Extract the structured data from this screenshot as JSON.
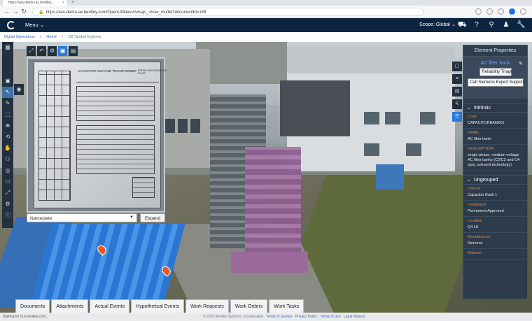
{
  "browser": {
    "tab_title": "https://asv-demo-ax.bentley...",
    "url": "https://asv-demo-ax.bentley.com/OpenUtilities/#/visajs_show_model?documentId=189"
  },
  "header": {
    "menu_label": "Menu",
    "scope_label": "Scope: Global"
  },
  "breadcrumb": {
    "items": [
      "Digital Operations",
      "Home",
      "3D Spatial Explorer"
    ]
  },
  "nameplate": {
    "plate_title": "CAPACITOR VOLTAGE TRANSFORMER",
    "plate_right_title": "RATING AND DIAGRAMS PLATE",
    "select_value": "Nameplate",
    "expand_label": "Expand"
  },
  "bottom_tabs": [
    "Documents",
    "Attachments",
    "Actual Events",
    "Hypothetical Events",
    "Work Requests",
    "Work Orders",
    "Work Tasks"
  ],
  "status": {
    "left": "Waiting for ts.b.bentley.com...",
    "copyright": "© 2019 Bentley Systems, Incorporated",
    "links": [
      "Terms of Service",
      "Privacy Policy",
      "Terms of Use",
      "Legal Notices"
    ]
  },
  "properties": {
    "panel_title": "Element Properties",
    "element_name": "AC filter bank",
    "reliability_button": "Reliability Triage",
    "siemens_button": "Call Siemens Expert Support",
    "intrinsic_label": "Intrinsic",
    "ungrouped_label": "Ungrouped",
    "intrinsic_fields": [
      {
        "label": "Code",
        "value": "CAPACITORBANK01"
      },
      {
        "label": "NAME",
        "value": "AC filter bank"
      },
      {
        "label": "DESCRIPTION",
        "value": "single-phase, medium-voltage AC filter banks (C2/C3 and C4-type, unfused technology)"
      }
    ],
    "ungrouped_fields": [
      {
        "label": "IdShort",
        "value": "Capacitor Bank 1"
      },
      {
        "label": "Installation",
        "value": "Permanent Approved"
      },
      {
        "label": "Location",
        "value": "Q4 L8"
      },
      {
        "label": "Manufacturer",
        "value": "Siemens"
      },
      {
        "label": "Material",
        "value": ""
      }
    ]
  },
  "icons": {
    "header": [
      "basket-icon",
      "help-icon",
      "search-icon",
      "user-icon",
      "wrench-icon"
    ],
    "colors": {
      "header_bg": "#0d2440",
      "accent_blue": "#2a7ad6",
      "field_label": "#e3893b"
    }
  }
}
